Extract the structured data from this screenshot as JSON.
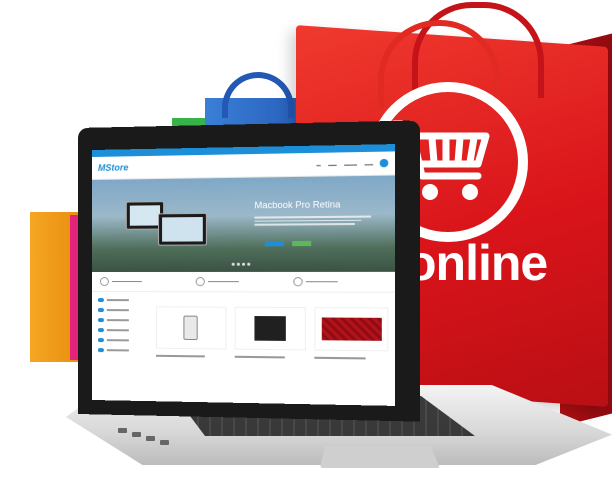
{
  "brand": {
    "logo_text": "MStore"
  },
  "hero": {
    "title": "Macbook Pro Retina"
  },
  "bag": {
    "caption": "online"
  },
  "colors": {
    "bag_red": "#d9141a",
    "site_accent": "#1d8fd8",
    "button_green": "#5cb85c"
  },
  "icons": [
    "shopping-cart-icon",
    "cart-bubble-icon"
  ]
}
